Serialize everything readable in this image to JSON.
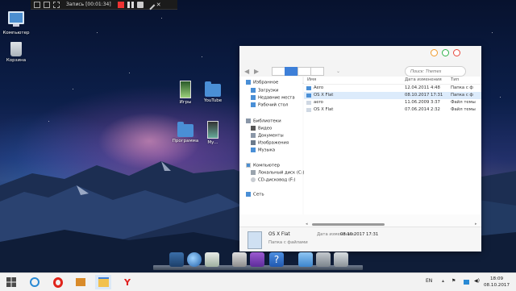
{
  "recorder": {
    "status": "Запись [00:01:34]"
  },
  "desktop": {
    "icons": [
      {
        "label": "Компьютер"
      },
      {
        "label": "Корзина"
      },
      {
        "label": "Игры"
      },
      {
        "label": "YouTube"
      },
      {
        "label": "Программа"
      },
      {
        "label": "Му..."
      }
    ]
  },
  "explorer": {
    "search_placeholder": "Поиск: Themes",
    "nav": {
      "favorites": {
        "label": "Избранное",
        "items": [
          "Загрузки",
          "Недавние места",
          "Рабочий стол"
        ]
      },
      "libraries": {
        "label": "Библиотеки",
        "items": [
          "Видео",
          "Документы",
          "Изображения",
          "Музыка"
        ]
      },
      "computer": {
        "label": "Компьютер",
        "items": [
          "Локальный диск (C:)",
          "CD-дисковод (F:)"
        ]
      },
      "network": {
        "label": "Сеть"
      }
    },
    "columns": {
      "name": "Имя",
      "date": "Дата изменения",
      "type": "Тип"
    },
    "files": [
      {
        "name": "Aero",
        "date": "12.04.2011 4:48",
        "type": "Папка с ф",
        "kind": "folder"
      },
      {
        "name": "OS X Flat",
        "date": "08.10.2017 17:31",
        "type": "Папка с ф",
        "kind": "folder"
      },
      {
        "name": "aero",
        "date": "11.06.2009 3:37",
        "type": "Файл темы",
        "kind": "file"
      },
      {
        "name": "OS X Flat",
        "date": "07.06.2014 2:32",
        "type": "Файл темы",
        "kind": "file"
      }
    ],
    "status": {
      "name": "OS X Flat",
      "type": "Папка с файлами",
      "modified_label": "Дата изменения:",
      "modified_value": "08.10.2017 17:31"
    }
  },
  "taskbar": {
    "lang": "EN",
    "time": "18:09",
    "date": "08.10.2017"
  },
  "colors": {
    "accent": "#3d7fd8",
    "folder": "#4a8fd6",
    "close": "#f09a2a",
    "min": "#f2c230",
    "max": "#30b34a"
  }
}
